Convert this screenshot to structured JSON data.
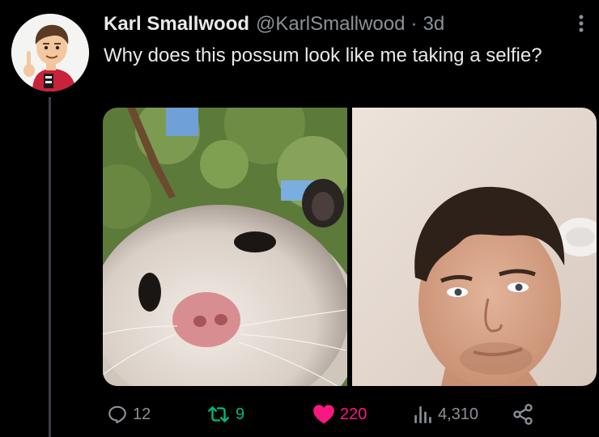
{
  "tweet": {
    "author": {
      "name": "Karl Smallwood",
      "handle": "@KarlSmallwood",
      "separator": "·",
      "time": "3d"
    },
    "text": "Why does this possum look like me taking a selfie?",
    "media": [
      {
        "name": "possum-selfie-photo",
        "kind": "photo"
      },
      {
        "name": "man-selfie-photo",
        "kind": "photo"
      }
    ],
    "actions": {
      "replies": "12",
      "retweets": "9",
      "likes": "220",
      "views": "4,310"
    },
    "icons": {
      "reply": "reply-icon",
      "retweet": "retweet-icon",
      "like": "heart-icon",
      "views": "views-icon",
      "share": "share-icon",
      "more": "more-icon"
    },
    "colors": {
      "background": "#000000",
      "text": "#e7e9ea",
      "muted": "#8b9198",
      "retweet_active": "#00ba7c",
      "like_active": "#f91880"
    }
  }
}
